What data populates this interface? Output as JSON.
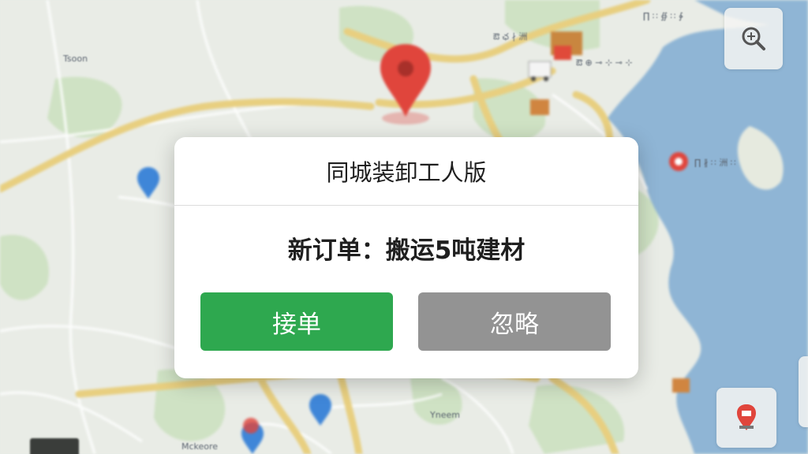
{
  "dialog": {
    "title": "同城装卸工人版",
    "message": "新订单：搬运5吨建材",
    "accept_label": "接单",
    "ignore_label": "忽略"
  },
  "map": {
    "labels": [
      "Tsoon",
      "Yneem",
      "Mckeore",
      "ఔ ఛ ∤ 洲",
      "ఔ ⊕ ⊸ ⊹ ⊸ ⊹",
      "∏ ∦ ∷ 洲 ∷",
      "∏ ∷ ∯ ∷ ∳"
    ],
    "icons": [
      "destination-pin-icon",
      "delivery-truck-icon",
      "cargo-box-icon",
      "blue-location-pin-icon",
      "red-place-marker-icon",
      "zoom-in-icon",
      "locate-me-icon"
    ]
  },
  "colors": {
    "accent_green": "#2ea84f",
    "ignore_gray": "#939393",
    "pin_red": "#e0453c",
    "water_blue": "#8cb4d4",
    "road_yellow": "#e8cf80"
  }
}
